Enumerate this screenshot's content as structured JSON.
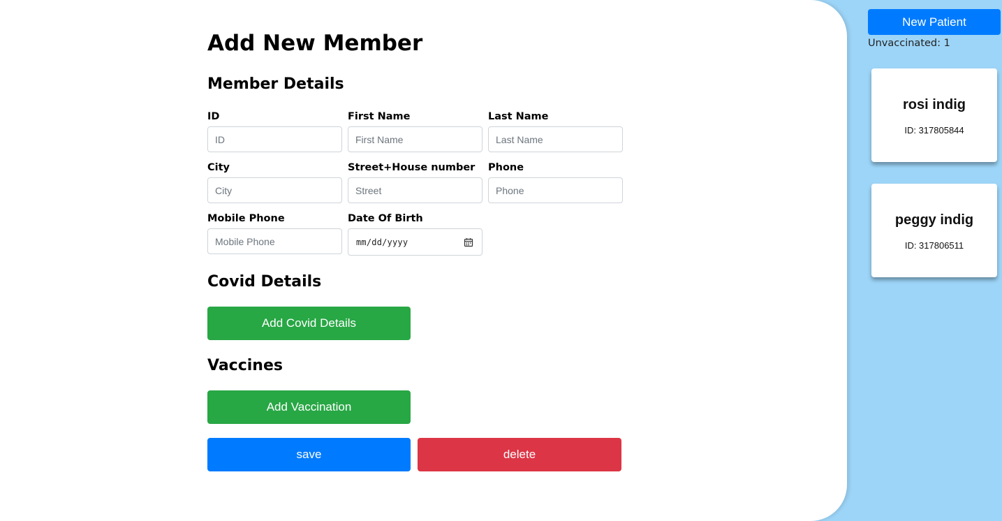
{
  "page_title": "Add New Member",
  "sections": {
    "member_details": "Member Details",
    "covid_details": "Covid Details",
    "vaccines": "Vaccines"
  },
  "fields": {
    "id": {
      "label": "ID",
      "placeholder": "ID"
    },
    "first_name": {
      "label": "First Name",
      "placeholder": "First Name"
    },
    "last_name": {
      "label": "Last Name",
      "placeholder": "Last Name"
    },
    "city": {
      "label": "City",
      "placeholder": "City"
    },
    "street": {
      "label": "Street+House number",
      "placeholder": "Street"
    },
    "phone": {
      "label": "Phone",
      "placeholder": "Phone"
    },
    "mobile_phone": {
      "label": "Mobile Phone",
      "placeholder": "Mobile Phone"
    },
    "date_of_birth": {
      "label": "Date Of Birth",
      "value": "mm/dd/yyyy",
      "icon": "calendar-icon"
    }
  },
  "buttons": {
    "add_covid": "Add Covid Details",
    "add_vaccination": "Add Vaccination",
    "save": "save",
    "delete": "delete"
  },
  "sidebar": {
    "new_patient": "New Patient",
    "unvaccinated": "Unvaccinated: 1",
    "patients": [
      {
        "name": "rosi indig",
        "id_text": "ID: 317805844"
      },
      {
        "name": "peggy indig",
        "id_text": "ID: 317806511"
      }
    ]
  },
  "colors": {
    "sidebar_bg": "#9dd5f8",
    "primary": "#007bff",
    "success": "#28a745",
    "danger": "#dc3545"
  }
}
